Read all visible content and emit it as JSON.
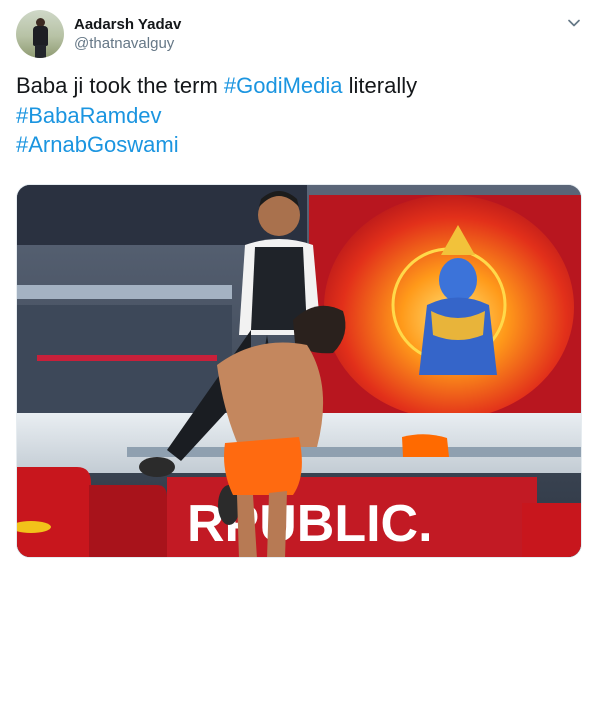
{
  "tweet": {
    "author": {
      "display_name": "Aadarsh Yadav",
      "handle": "@thatnavalguy"
    },
    "text_prefix": "Baba ji took the term ",
    "hashtag_1": "#GodiMedia",
    "text_suffix": " literally",
    "hashtag_2": "#BabaRamdev",
    "hashtag_3": "#ArnabGoswami",
    "menu_icon": "chevron-down-icon",
    "media": {
      "sign_text": "RPUBLIC.",
      "accent_colors": {
        "hashtag": "#1b95e0",
        "screen_red": "#d8201c",
        "saffron": "#ff6a00"
      }
    }
  }
}
